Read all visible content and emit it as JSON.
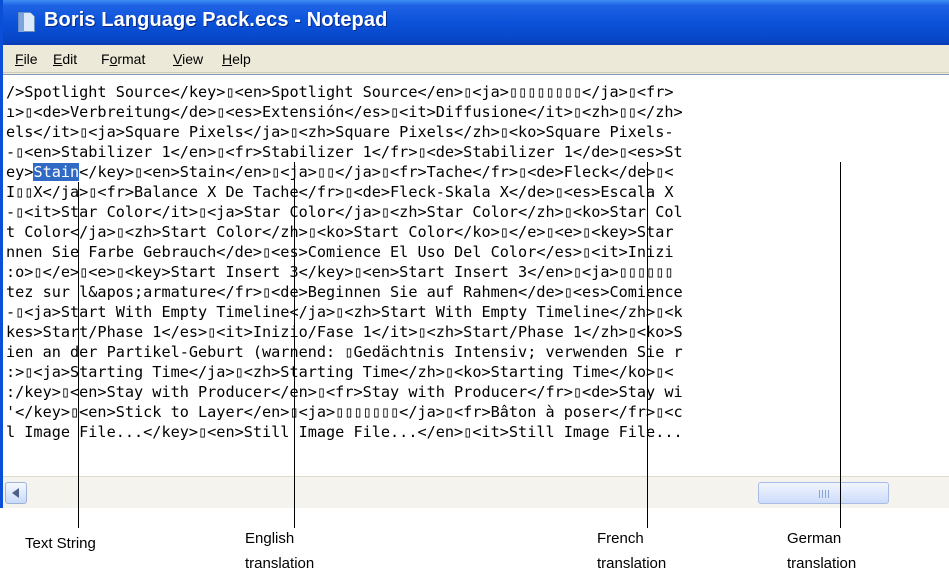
{
  "window": {
    "title": "Boris Language Pack.ecs - Notepad",
    "icon": "notepad-icon"
  },
  "menu": {
    "items": [
      {
        "label": "File",
        "accel": "F",
        "rest": "ile"
      },
      {
        "label": "Edit",
        "accel": "E",
        "rest": "dit"
      },
      {
        "label": "Format",
        "prefix": "F",
        "accel": "o",
        "rest": "rmat"
      },
      {
        "label": "View",
        "accel": "V",
        "rest": "iew"
      },
      {
        "label": "Help",
        "accel": "H",
        "rest": "elp"
      }
    ]
  },
  "editor": {
    "selected_text": "Stain",
    "lines": [
      "/>Spotlight Source</key>▯<en>Spotlight Source</en>▯<ja>▯▯▯▯▯▯▯▯</ja>▯<fr>",
      "ı>▯<de>Verbreitung</de>▯<es>Extensión</es>▯<it>Diffusione</it>▯<zh>▯▯</zh>",
      "els</it>▯<ja>Square Pixels</ja>▯<zh>Square Pixels</zh>▯<ko>Square Pixels-",
      "-▯<en>Stabilizer 1</en>▯<fr>Stabilizer 1</fr>▯<de>Stabilizer 1</de>▯<es>St",
      "ey>",
      "I▯▯X</ja>▯<fr>Balance X De Tache</fr>▯<de>Fleck-Skala X</de>▯<es>Escala X",
      "-▯<it>Star Color</it>▯<ja>Star Color</ja>▯<zh>Star Color</zh>▯<ko>Star Col",
      "t Color</ja>▯<zh>Start Color</zh>▯<ko>Start Color</ko>▯</e>▯<e>▯<key>Star",
      "nnen Sie Farbe Gebrauch</de>▯<es>Comience El Uso Del Color</es>▯<it>Inizi",
      ":o>▯</e>▯<e>▯<key>Start Insert 3</key>▯<en>Start Insert 3</en>▯<ja>▯▯▯▯▯▯",
      "tez sur l&apos;armature</fr>▯<de>Beginnen Sie auf Rahmen</de>▯<es>Comience",
      "-▯<ja>Start With Empty Timeline</ja>▯<zh>Start With Empty Timeline</zh>▯<k",
      "kes>Start/Phase 1</es>▯<it>Inizio/Fase 1</it>▯<zh>Start/Phase 1</zh>▯<ko>S",
      "ien an der Partikel-Geburt (warnend: ▯Gedächtnis Intensiv; verwenden Sie r",
      ":>▯<ja>Starting Time</ja>▯<zh>Starting Time</zh>▯<ko>Starting Time</ko>▯<",
      ":/key>▯<en>Stay with Producer</en>▯<fr>Stay with Producer</fr>▯<de>Stay wi",
      "'</key>▯<en>Stick to Layer</en>▯<ja>▯▯▯▯▯▯▯</ja>▯<fr>Bâton à poser</fr>▯<c",
      "l Image File...</key>▯<en>Still Image File...</en>▯<it>Still Image File..."
    ],
    "line5_after": "</key>▯<en>Stain</en>▯<ja>▯▯</ja>▯<fr>Tache</fr>▯<de>Fleck</de>▯<"
  },
  "annotations": [
    {
      "lines": [
        "Text String"
      ]
    },
    {
      "lines": [
        "English",
        "translation"
      ]
    },
    {
      "lines": [
        "French",
        "translation"
      ]
    },
    {
      "lines": [
        "German",
        "translation"
      ]
    }
  ]
}
